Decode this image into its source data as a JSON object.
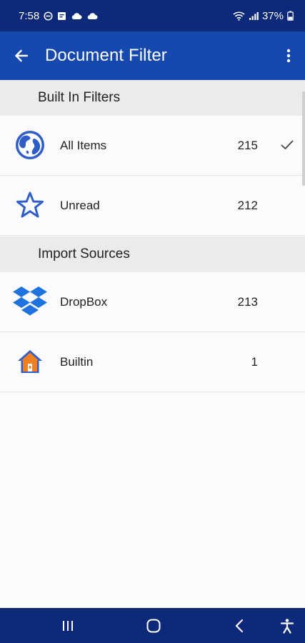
{
  "status_bar": {
    "time": "7:58",
    "battery": "37%",
    "icons": [
      "minus-circle-icon",
      "notification-icon",
      "cloud-icon",
      "cloud-icon",
      "wifi-icon",
      "signal-icon",
      "battery-icon"
    ]
  },
  "app_bar": {
    "title": "Document Filter",
    "back_icon": "arrow-left-icon",
    "menu_icon": "more-vertical-icon"
  },
  "sections": [
    {
      "header": "Built In Filters",
      "items": [
        {
          "label": "All Items",
          "count": "215",
          "icon": "globe-icon",
          "selected": true
        },
        {
          "label": "Unread",
          "count": "212",
          "icon": "star-icon",
          "selected": false
        }
      ]
    },
    {
      "header": "Import Sources",
      "items": [
        {
          "label": "DropBox",
          "count": "213",
          "icon": "dropbox-icon",
          "selected": false
        },
        {
          "label": "Builtin",
          "count": "1",
          "icon": "house-icon",
          "selected": false
        }
      ]
    }
  ],
  "colors": {
    "status_bar": "#0d2a7a",
    "app_bar": "#1549ad",
    "accent_blue": "#2f5ec8",
    "dropbox_blue": "#1f73e0",
    "house_orange": "#f07f22",
    "section_bg": "#ebebeb"
  },
  "nav_bar": {
    "buttons": [
      "recent-apps-icon",
      "home-icon",
      "back-icon",
      "accessibility-icon"
    ]
  }
}
